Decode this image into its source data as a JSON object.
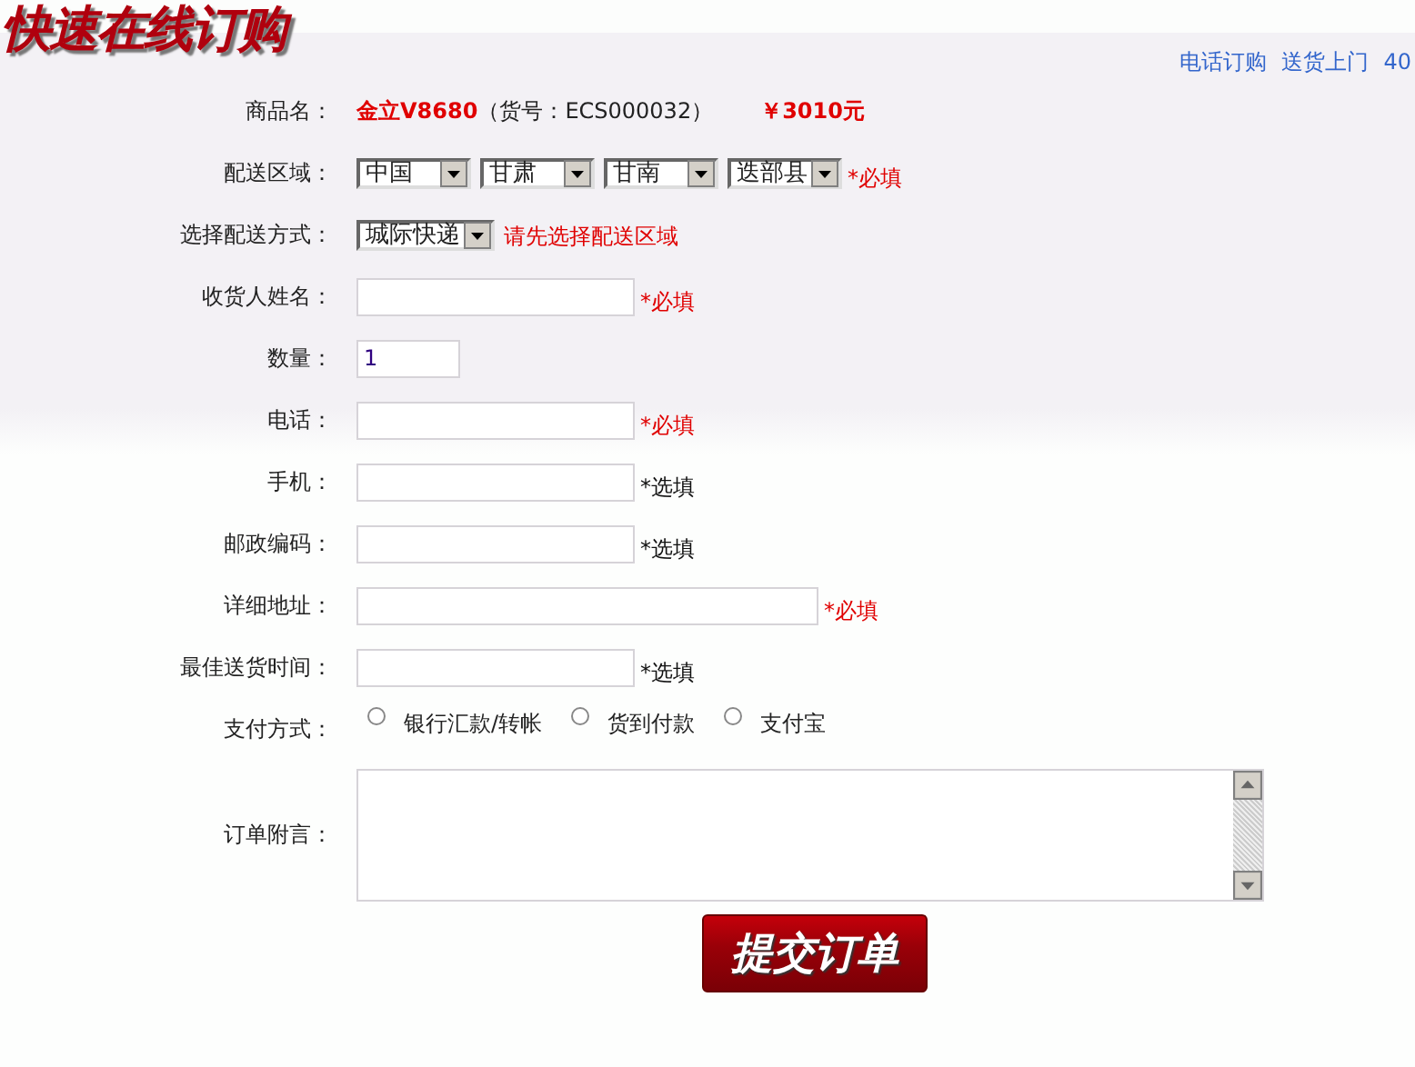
{
  "header": {
    "title": "快速在线订购",
    "links": [
      "电话订购",
      "送货上门",
      "40"
    ]
  },
  "product": {
    "label": "商品名：",
    "name": "金立V8680",
    "code": "（货号：ECS000032）",
    "price": "￥3010元"
  },
  "region": {
    "label": "配送区域：",
    "selects": [
      "中国",
      "甘肃",
      "甘南",
      "迭部县"
    ],
    "note": "*必填",
    "required": true
  },
  "shipping": {
    "label": "选择配送方式：",
    "select": "城际快递",
    "note": "请先选择配送区域"
  },
  "fields": [
    {
      "label": "收货人姓名：",
      "kind": "normal",
      "note": "*必填",
      "required": true
    },
    {
      "label": "数量：",
      "kind": "short",
      "value": "1"
    },
    {
      "label": "电话：",
      "kind": "normal",
      "note": "*必填",
      "required": true
    },
    {
      "label": "手机：",
      "kind": "normal",
      "note": "*选填",
      "required": false
    },
    {
      "label": "邮政编码：",
      "kind": "normal",
      "note": "*选填",
      "required": false
    },
    {
      "label": "详细地址：",
      "kind": "wide",
      "note": "*必填",
      "required": true
    },
    {
      "label": "最佳送货时间：",
      "kind": "normal",
      "note": "*选填",
      "required": false
    }
  ],
  "payment": {
    "label": "支付方式：",
    "options": [
      {
        "label": "银行汇款/转帐",
        "selected": false
      },
      {
        "label": "货到付款",
        "selected": false
      },
      {
        "label": "支付宝",
        "selected": false
      }
    ]
  },
  "remarks": {
    "label": "订单附言："
  },
  "submit": "提交订单"
}
